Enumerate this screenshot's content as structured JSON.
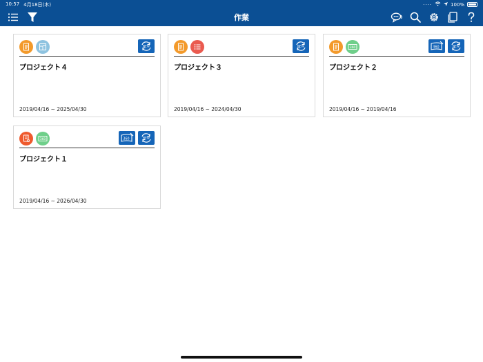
{
  "status_bar": {
    "time": "10:57",
    "date": "4月18日(木)",
    "battery": "100%"
  },
  "nav": {
    "title": "作業",
    "left_icons": [
      "menu-icon",
      "filter-icon"
    ],
    "right_icons": [
      "chat-icon",
      "search-icon",
      "gear-icon",
      "pages-icon",
      "help-icon"
    ]
  },
  "colors": {
    "brand": "#0b4f94",
    "action": "#1565b8",
    "orange": "#f39a2b",
    "light_blue": "#8ec3e0",
    "red": "#ea5a4f",
    "green": "#6fcf8a",
    "red_orange": "#ef5a2d"
  },
  "projects": [
    {
      "title": "プロジェクト４",
      "dates": "2019/04/16 ~ 2025/04/30",
      "type_icons": [
        "document-icon",
        "blueprint-icon"
      ],
      "action_icons": [
        "new-sync-icon"
      ]
    },
    {
      "title": "プロジェクト３",
      "dates": "2019/04/16 ~ 2024/04/30",
      "type_icons": [
        "document-icon",
        "checklist-icon"
      ],
      "action_icons": [
        "new-sync-icon"
      ]
    },
    {
      "title": "プロジェクト２",
      "dates": "2019/04/16 ~ 2019/04/16",
      "type_icons": [
        "document-icon",
        "panorama-360-icon"
      ],
      "action_icons": [
        "panorama-360-edit-icon",
        "new-sync-icon"
      ]
    },
    {
      "title": "プロジェクト１",
      "dates": "2019/04/16 ~ 2026/04/30",
      "type_icons": [
        "document-upload-icon",
        "panorama-360-icon"
      ],
      "action_icons": [
        "panorama-360-edit-icon",
        "new-sync-icon"
      ]
    }
  ],
  "labels": {
    "panorama": "360",
    "new": "NEW"
  }
}
